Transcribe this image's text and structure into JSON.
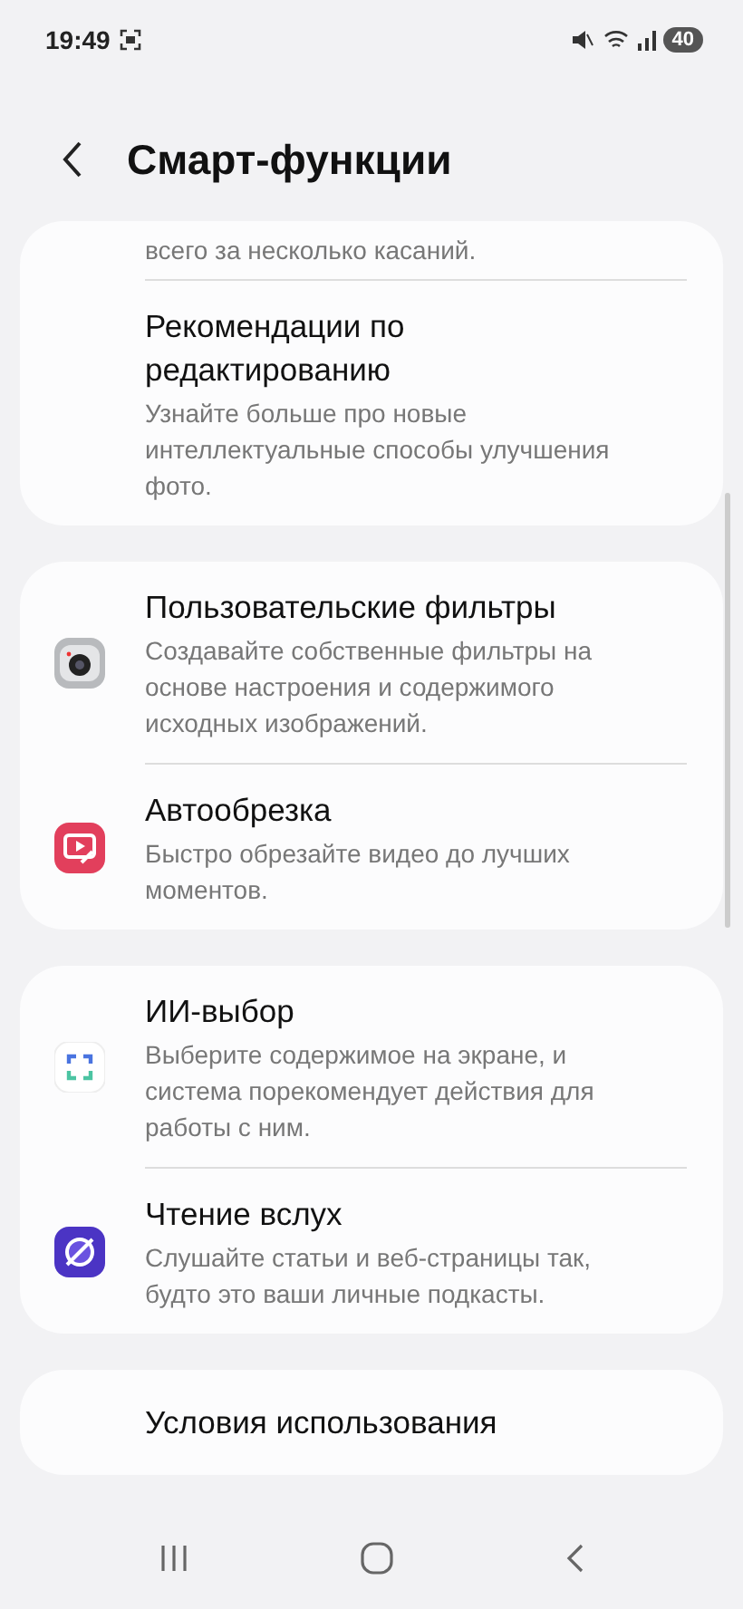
{
  "status_bar": {
    "time": "19:49",
    "battery": "40"
  },
  "header": {
    "title": "Смарт-функции"
  },
  "groups": [
    {
      "items": [
        {
          "kind": "plain",
          "subtitle": "всего за несколько касаний."
        },
        {
          "kind": "plain",
          "title": "Рекомендации по редактированию",
          "subtitle": "Узнайте больше про новые интеллектуальные способы улучшения фото."
        }
      ]
    },
    {
      "items": [
        {
          "kind": "camera",
          "title": "Пользовательские фильтры",
          "subtitle": "Создавайте собственные фильтры на основе настроения и содержимого исходных изображений."
        },
        {
          "kind": "video",
          "title": "Автообрезка",
          "subtitle": "Быстро обрезайте видео до лучших моментов."
        }
      ]
    },
    {
      "items": [
        {
          "kind": "select",
          "title": "ИИ-выбор",
          "subtitle": "Выберите содержимое на экране, и система порекомендует действия для работы с ним."
        },
        {
          "kind": "planet",
          "title": "Чтение вслух",
          "subtitle": "Слушайте статьи и веб-страницы так, будто это ваши личные подкасты."
        }
      ]
    },
    {
      "items": [
        {
          "kind": "plain",
          "title": "Условия использования"
        }
      ]
    }
  ]
}
